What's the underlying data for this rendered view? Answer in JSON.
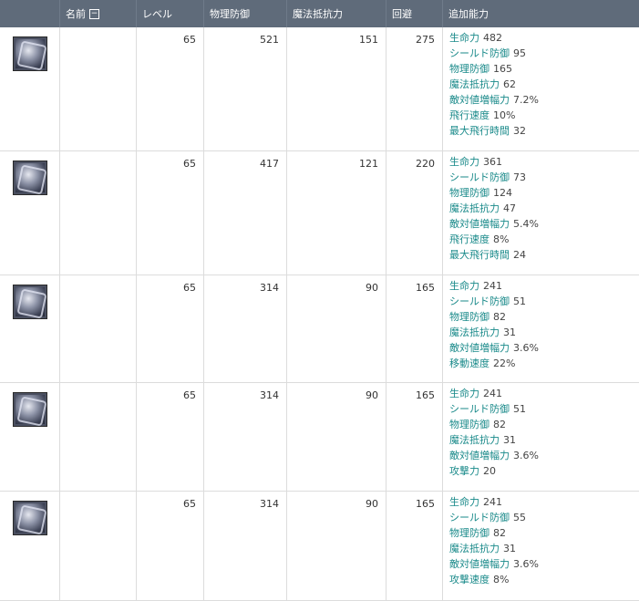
{
  "header": {
    "icon_col": "",
    "name": "名前",
    "sort_glyph": "−",
    "level": "レベル",
    "phys_def": "物理防御",
    "mag_res": "魔法抵抗力",
    "evasion": "回避",
    "bonus": "追加能力"
  },
  "rows": [
    {
      "icon": "armor-chest-icon",
      "name": "",
      "level": "65",
      "phys_def": "521",
      "mag_res": "151",
      "evasion": "275",
      "bonus": [
        {
          "name": "生命力",
          "value": "482"
        },
        {
          "name": "シールド防御",
          "value": "95"
        },
        {
          "name": "物理防御",
          "value": "165"
        },
        {
          "name": "魔法抵抗力",
          "value": "62"
        },
        {
          "name": "敵対値増幅力",
          "value": "7.2%"
        },
        {
          "name": "飛行速度",
          "value": "10%"
        },
        {
          "name": "最大飛行時間",
          "value": "32"
        }
      ]
    },
    {
      "icon": "armor-legs-icon",
      "name": "",
      "level": "65",
      "phys_def": "417",
      "mag_res": "121",
      "evasion": "220",
      "bonus": [
        {
          "name": "生命力",
          "value": "361"
        },
        {
          "name": "シールド防御",
          "value": "73"
        },
        {
          "name": "物理防御",
          "value": "124"
        },
        {
          "name": "魔法抵抗力",
          "value": "47"
        },
        {
          "name": "敵対値増幅力",
          "value": "5.4%"
        },
        {
          "name": "飛行速度",
          "value": "8%"
        },
        {
          "name": "最大飛行時間",
          "value": "24"
        }
      ]
    },
    {
      "icon": "armor-boots-icon",
      "name": "",
      "level": "65",
      "phys_def": "314",
      "mag_res": "90",
      "evasion": "165",
      "bonus": [
        {
          "name": "生命力",
          "value": "241"
        },
        {
          "name": "シールド防御",
          "value": "51"
        },
        {
          "name": "物理防御",
          "value": "82"
        },
        {
          "name": "魔法抵抗力",
          "value": "31"
        },
        {
          "name": "敵対値増幅力",
          "value": "3.6%"
        },
        {
          "name": "移動速度",
          "value": "22%"
        }
      ]
    },
    {
      "icon": "armor-gloves-icon",
      "name": "",
      "level": "65",
      "phys_def": "314",
      "mag_res": "90",
      "evasion": "165",
      "bonus": [
        {
          "name": "生命力",
          "value": "241"
        },
        {
          "name": "シールド防御",
          "value": "51"
        },
        {
          "name": "物理防御",
          "value": "82"
        },
        {
          "name": "魔法抵抗力",
          "value": "31"
        },
        {
          "name": "敵対値増幅力",
          "value": "3.6%"
        },
        {
          "name": "攻撃力",
          "value": "20"
        }
      ]
    },
    {
      "icon": "armor-shoulders-icon",
      "name": "",
      "level": "65",
      "phys_def": "314",
      "mag_res": "90",
      "evasion": "165",
      "bonus": [
        {
          "name": "生命力",
          "value": "241"
        },
        {
          "name": "シールド防御",
          "value": "55"
        },
        {
          "name": "物理防御",
          "value": "82"
        },
        {
          "name": "魔法抵抗力",
          "value": "31"
        },
        {
          "name": "敵対値増幅力",
          "value": "3.6%"
        },
        {
          "name": "攻撃速度",
          "value": "8%"
        }
      ]
    }
  ]
}
